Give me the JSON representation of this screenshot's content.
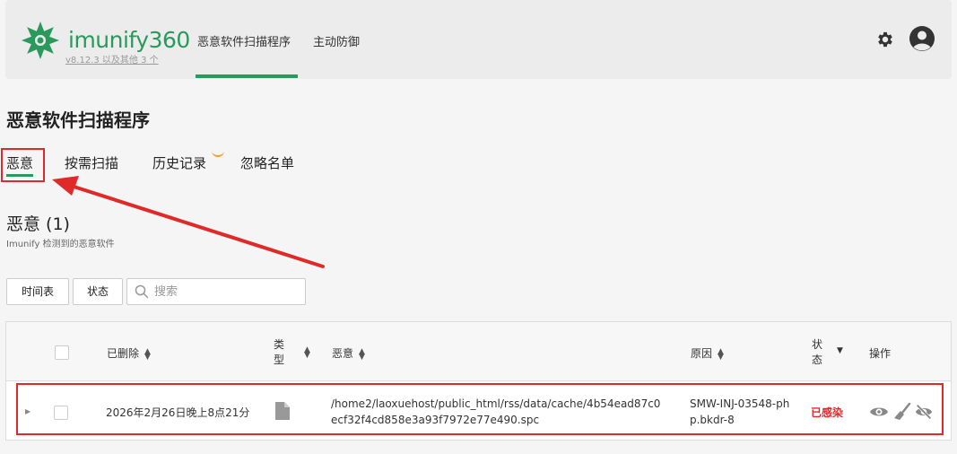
{
  "header": {
    "brand_text": "imunify",
    "brand_num": "360",
    "version": "v8.12.3 以及其他 3 个",
    "nav": [
      {
        "label": "恶意软件扫描程序",
        "active": true
      },
      {
        "label": "主动防御",
        "active": false
      }
    ],
    "accent": "#2a9a5c"
  },
  "page_title": "恶意软件扫描程序",
  "tabs": [
    {
      "label": "恶意",
      "active": true
    },
    {
      "label": "按需扫描"
    },
    {
      "label": "历史记录"
    },
    {
      "label": "忽略名单"
    }
  ],
  "section": {
    "title": "恶意 (1)",
    "subtitle": "Imunify 检测到的恶意软件"
  },
  "filters": {
    "timeline_label": "时间表",
    "status_label": "状态",
    "search_placeholder": "搜索"
  },
  "table": {
    "headers": {
      "deleted": "已删除",
      "type_line1": "类",
      "type_line2": "型",
      "malware": "恶意",
      "reason": "原因",
      "status_line1": "状",
      "status_line2": "态",
      "actions": "操作"
    },
    "rows": [
      {
        "date": "2026年2月26日晚上8点21分",
        "path_line1": "/home2/laoxuehost/public_html/rss/data/cache/4b54ead87c0",
        "path_line2": "ecf32f4cd858e3a93f7972e77e490.spc",
        "reason_line1": "SMW-INJ-03548-ph",
        "reason_line2": "p.bkdr-8",
        "status": "已感染"
      }
    ]
  },
  "colors": {
    "infected": "#e02a2a",
    "annotation": "#e02a2a"
  }
}
